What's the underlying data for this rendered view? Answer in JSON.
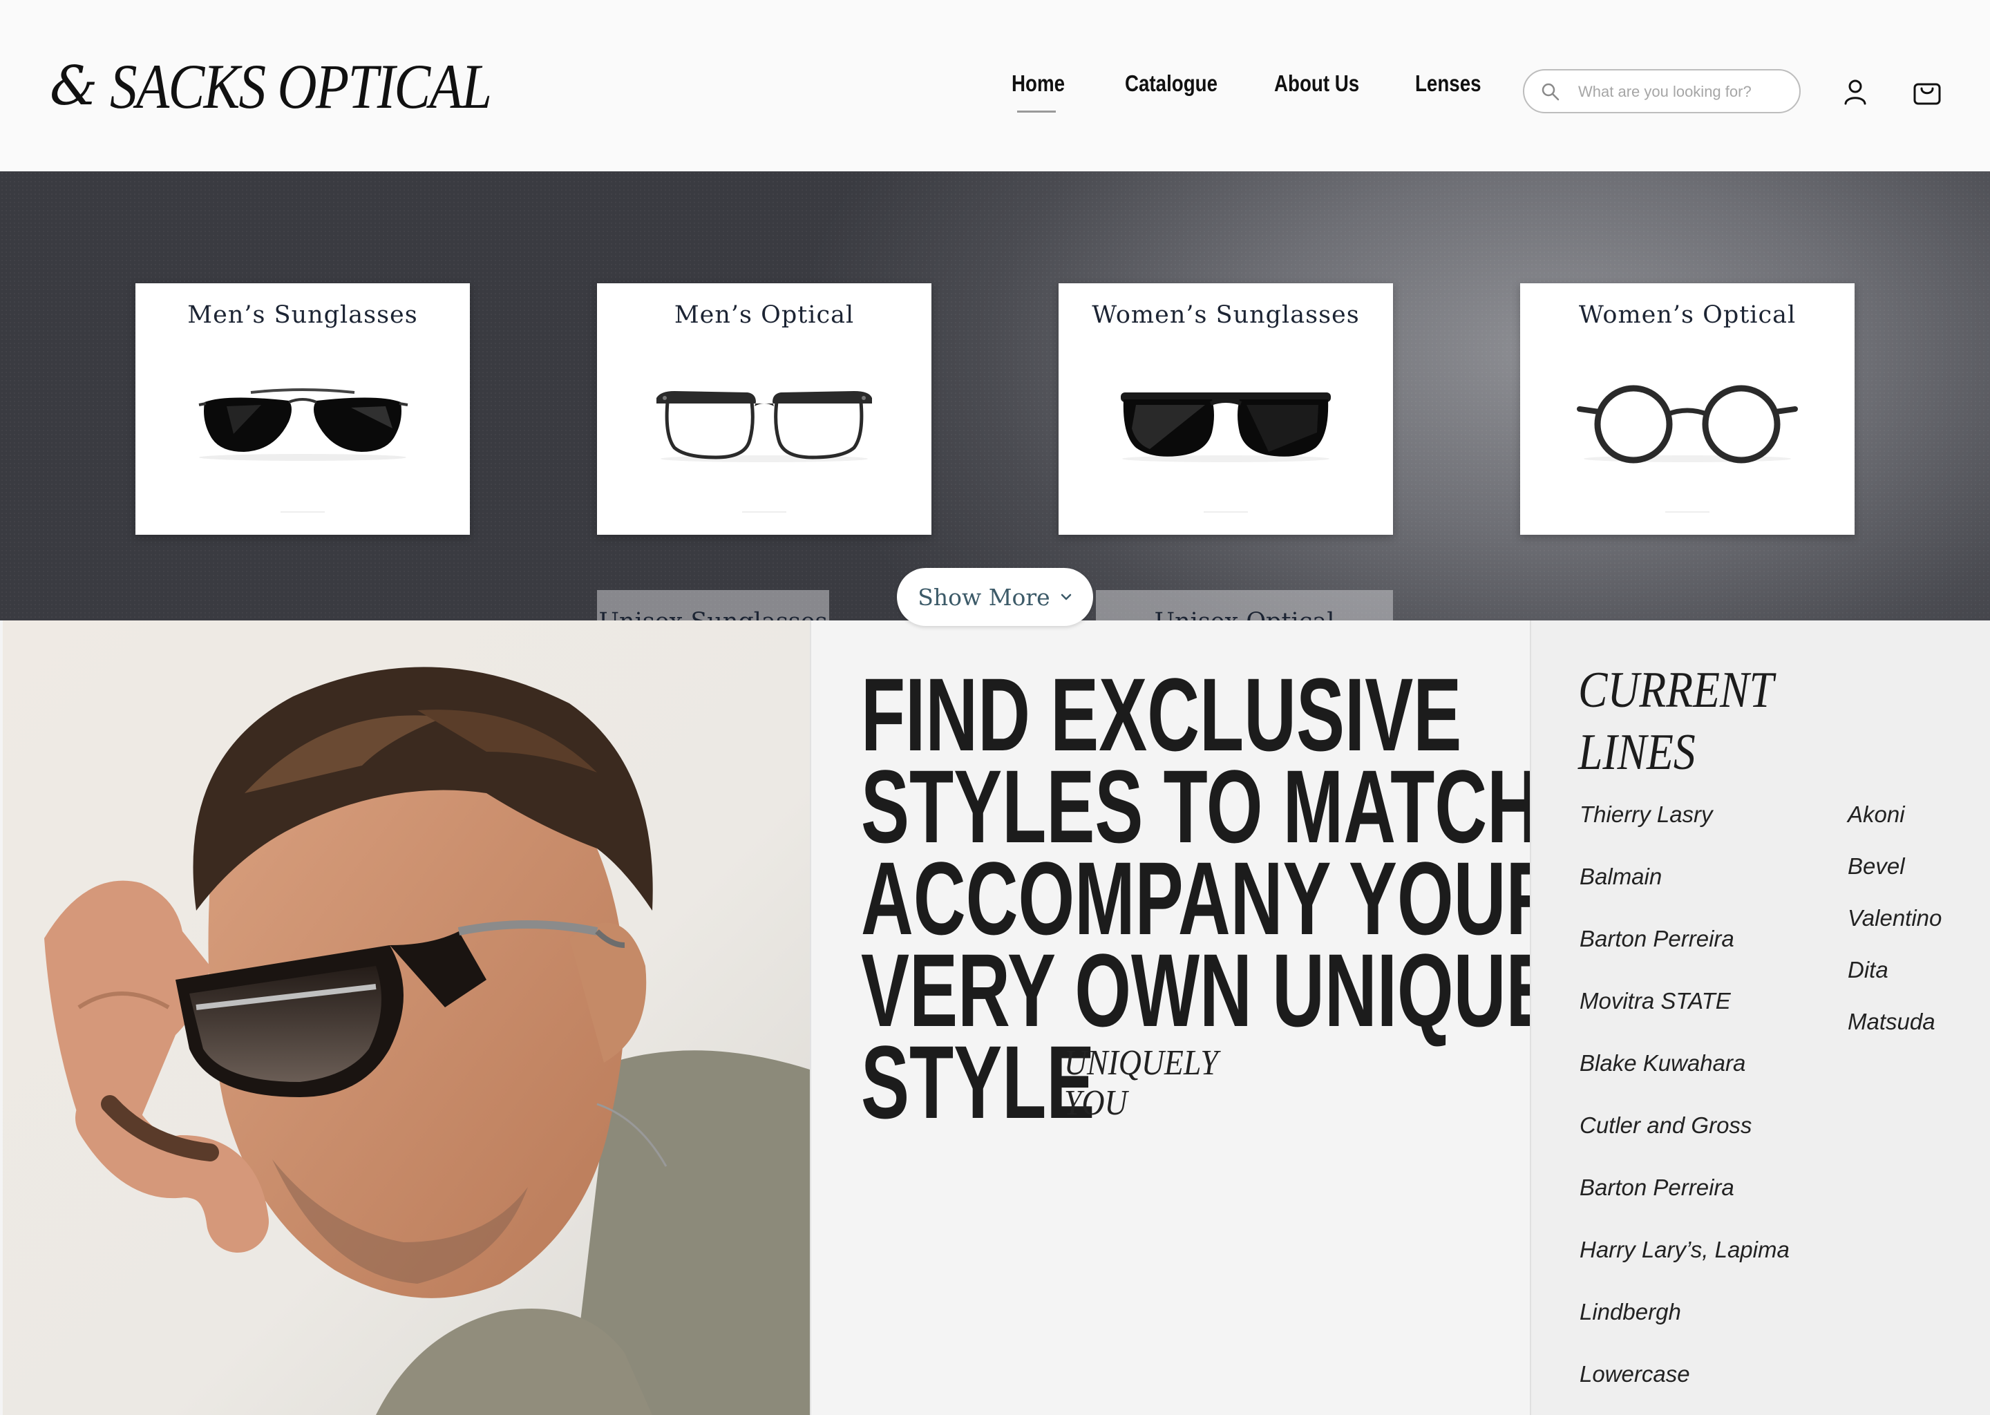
{
  "header": {
    "logo_mark": "&",
    "logo_text": "SACKS OPTICAL",
    "nav": [
      {
        "label": "Home",
        "active": true
      },
      {
        "label": "Catalogue"
      },
      {
        "label": "About Us"
      },
      {
        "label": "Lenses"
      }
    ],
    "search": {
      "placeholder": "What are you looking for?"
    },
    "icons": [
      "account-icon",
      "cart-icon"
    ]
  },
  "categories": [
    {
      "title": "Men’s Sunglasses",
      "icon": "aviator-sunglasses"
    },
    {
      "title": "Men’s Optical",
      "icon": "browline-glasses"
    },
    {
      "title": "Women’s Sunglasses",
      "icon": "round-sunglasses"
    },
    {
      "title": "Women’s Optical",
      "icon": "round-optical-glasses"
    }
  ],
  "categories_partial": [
    {
      "title": "Unisex Sunglasses"
    },
    {
      "title": "Unisex Optical"
    }
  ],
  "show_more": {
    "label": "Show More"
  },
  "hero": {
    "headline_lines": [
      "FIND EXCLUSIVE",
      "STYLES TO MATCH",
      "ACCOMPANY YOUR",
      "VERY OWN UNIQUE",
      "STYLE"
    ],
    "tagline_lines": [
      "UNIQUELY",
      "YOU"
    ]
  },
  "current_lines": {
    "title_lines": [
      "CURRENT",
      "LINES"
    ],
    "col1": [
      "Thierry Lasry",
      "Balmain",
      "Barton Perreira",
      "Movitra STATE",
      "Blake Kuwahara",
      "Cutler and Gross",
      "Barton Perreira",
      "Harry Lary’s, Lapima",
      "Lindbergh",
      "Lowercase"
    ],
    "col2": [
      "Akoni",
      "Bevel",
      "Valentino",
      "Dita",
      "Matsuda"
    ]
  },
  "colors": {
    "header_bg": "#fafafa",
    "band_dark": "#3a3b41",
    "band_light": "#8e8f94",
    "card_title": "#1c2433",
    "show_more_text": "#3c5a68",
    "text_dark": "#1c1c1c"
  }
}
